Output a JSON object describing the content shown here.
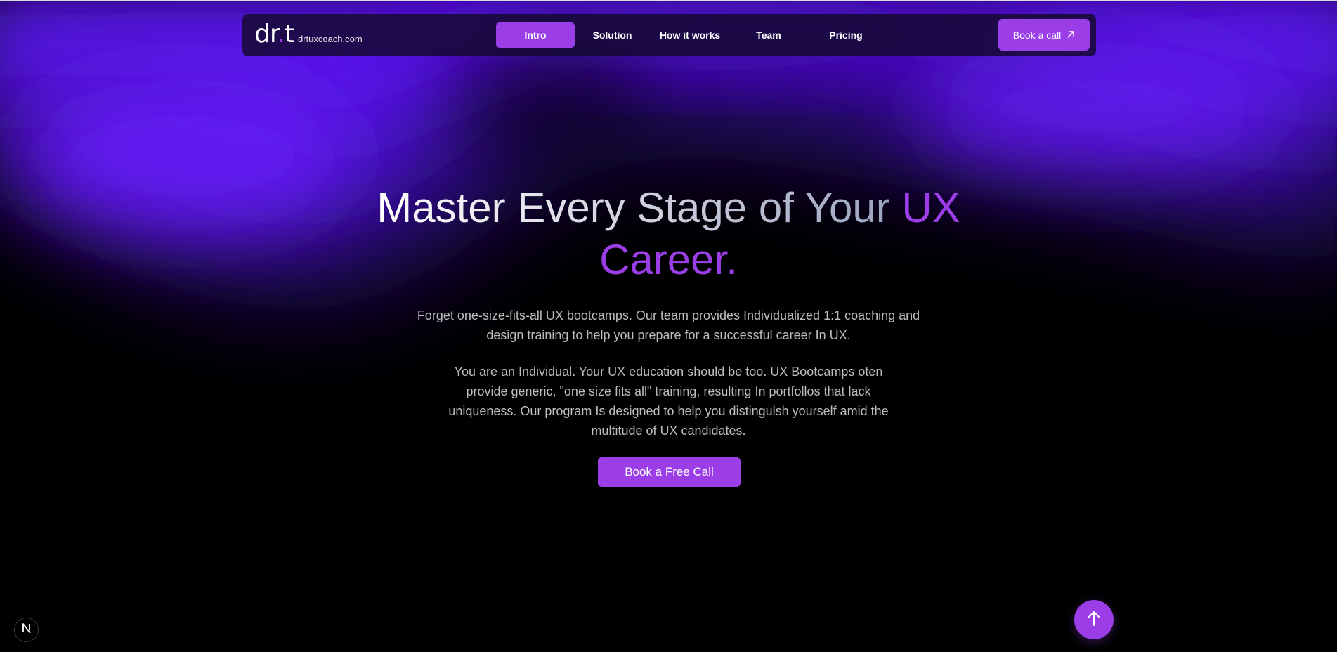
{
  "nav": {
    "logo_text": "dr",
    "logo_dot": ".",
    "logo_tail": "t",
    "domain": "drtuxcoach.com",
    "items": [
      {
        "label": "Intro",
        "active": true
      },
      {
        "label": "Solution",
        "active": false
      },
      {
        "label": "How it works",
        "active": false
      },
      {
        "label": "Team",
        "active": false
      },
      {
        "label": "Pricing",
        "active": false
      }
    ],
    "cta_label": "Book a call",
    "cta_icon": "arrow-up-right-icon"
  },
  "hero": {
    "title_part1": "Master Every Stage of Your ",
    "title_accent1": "UX",
    "title_accent2": "Career.",
    "paragraph1": "Forget one-size-fits-all UX bootcamps. Our team provides Individualized 1:1 coaching and design training to help you prepare for a successful career In UX.",
    "paragraph2": "You are an Individual. Your UX education should be too. UX Bootcamps oten provide generic, \"one size fits all\" training, resulting In portfollos that lack uniqueness. Our program Is designed to help you distingulsh yourself amid the multitude of UX candidates.",
    "cta_label": "Book a Free Call"
  },
  "floating": {
    "scroll_top_icon": "arrow-up-icon",
    "badge_letter": "N"
  },
  "colors": {
    "accent": "#9b3ee8",
    "glow": "#5b14f0",
    "background": "#000000"
  }
}
